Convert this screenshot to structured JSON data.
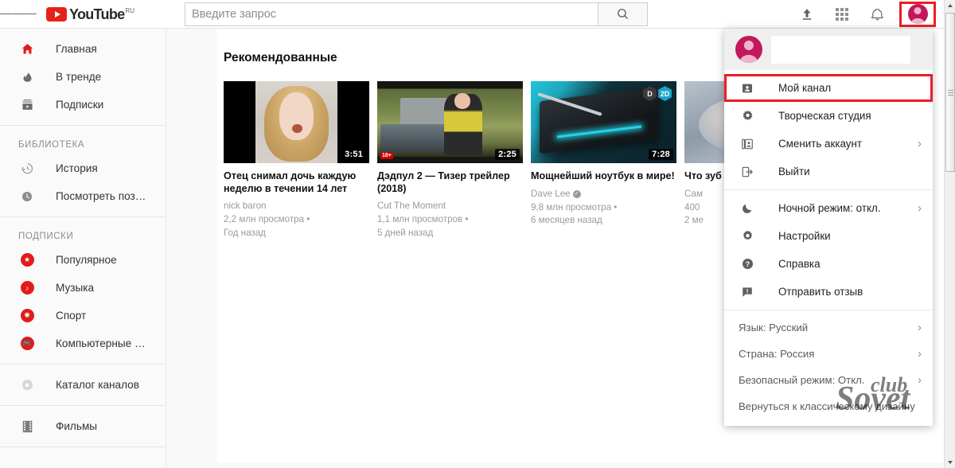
{
  "header": {
    "menu_icon": "hamburger-icon",
    "logo_text": "YouTube",
    "logo_country": "RU",
    "search_placeholder": "Введите запрос",
    "search_value": "",
    "search_icon": "search-icon",
    "upload_icon": "upload-icon",
    "apps_icon": "apps-grid-icon",
    "notifications_icon": "bell-icon",
    "avatar_icon": "account-avatar"
  },
  "sidebar": {
    "primary": [
      {
        "label": "Главная",
        "icon": "home-icon",
        "active": true
      },
      {
        "label": "В тренде",
        "icon": "trending-flame-icon",
        "active": false
      },
      {
        "label": "Подписки",
        "icon": "subscriptions-icon",
        "active": false
      }
    ],
    "library_heading": "БИБЛИОТЕКА",
    "library": [
      {
        "label": "История",
        "icon": "history-icon"
      },
      {
        "label": "Посмотреть поз…",
        "icon": "watch-later-clock-icon"
      }
    ],
    "subs_heading": "ПОДПИСКИ",
    "subscriptions": [
      {
        "label": "Популярное",
        "icon": "star-channel-icon"
      },
      {
        "label": "Музыка",
        "icon": "music-note-channel-icon"
      },
      {
        "label": "Спорт",
        "icon": "sports-ball-channel-icon"
      },
      {
        "label": "Компьютерные …",
        "icon": "gaming-controller-channel-icon"
      }
    ],
    "browse": [
      {
        "label": "Каталог каналов",
        "icon": "plus-circle-icon"
      }
    ],
    "more": [
      {
        "label": "Фильмы",
        "icon": "film-strip-icon"
      }
    ]
  },
  "main": {
    "section_title": "Рекомендованные",
    "videos": [
      {
        "title": "Отец снимал дочь каждую неделю в течении 14 лет",
        "channel": "nick baron",
        "views": "2,2 млн просмотра •",
        "age": "Год назад",
        "duration": "3:51",
        "verified": false,
        "age_badge": "",
        "hex_badges": []
      },
      {
        "title": "Дэдпул 2 — Тизер трейлер (2018)",
        "channel": "Cut The Moment",
        "views": "1,1 млн просмотров •",
        "age": "5 дней назад",
        "duration": "2:25",
        "verified": false,
        "age_badge": "18+",
        "hex_badges": []
      },
      {
        "title": "Мощнейший ноутбук в мире!",
        "channel": "Dave Lee",
        "views": "9,8 млн просмотра •",
        "age": "6 месяцев назад",
        "duration": "7:28",
        "verified": true,
        "age_badge": "",
        "hex_badges": [
          "D",
          "2D"
        ]
      },
      {
        "title": "Что зуб",
        "channel": "Сам",
        "views": "400",
        "age": "2 ме",
        "duration": "",
        "verified": false,
        "age_badge": "",
        "hex_badges": []
      }
    ]
  },
  "account_menu": {
    "account_name": "",
    "items_primary": [
      {
        "label": "Мой канал",
        "icon": "person-card-icon",
        "arrow": false,
        "highlighted": true
      },
      {
        "label": "Творческая студия",
        "icon": "gear-star-icon",
        "arrow": false,
        "highlighted": false
      },
      {
        "label": "Сменить аккаунт",
        "icon": "switch-account-icon",
        "arrow": true,
        "highlighted": false
      },
      {
        "label": "Выйти",
        "icon": "sign-out-icon",
        "arrow": false,
        "highlighted": false
      }
    ],
    "items_settings": [
      {
        "label": "Ночной режим: откл.",
        "icon": "moon-icon",
        "arrow": true
      },
      {
        "label": "Настройки",
        "icon": "gear-icon",
        "arrow": false
      },
      {
        "label": "Справка",
        "icon": "help-circle-icon",
        "arrow": false
      },
      {
        "label": "Отправить отзыв",
        "icon": "feedback-icon",
        "arrow": false
      }
    ],
    "items_locale": [
      {
        "label": "Язык: Русский",
        "arrow": true
      },
      {
        "label": "Страна: Россия",
        "arrow": true
      },
      {
        "label": "Безопасный режим: Откл.",
        "arrow": true
      },
      {
        "label": "Вернуться к классическому дизайну",
        "arrow": false
      }
    ]
  },
  "watermark": {
    "line1": "Sovet",
    "line2": "club"
  },
  "colors": {
    "brand_red": "#e62117",
    "highlight_red": "#ee1c25",
    "avatar_pink": "#c2185b",
    "sidebar_bg": "#fafafa",
    "page_bg": "#f9f9f9",
    "text_primary": "#030303",
    "text_secondary": "#9a9a9a"
  }
}
